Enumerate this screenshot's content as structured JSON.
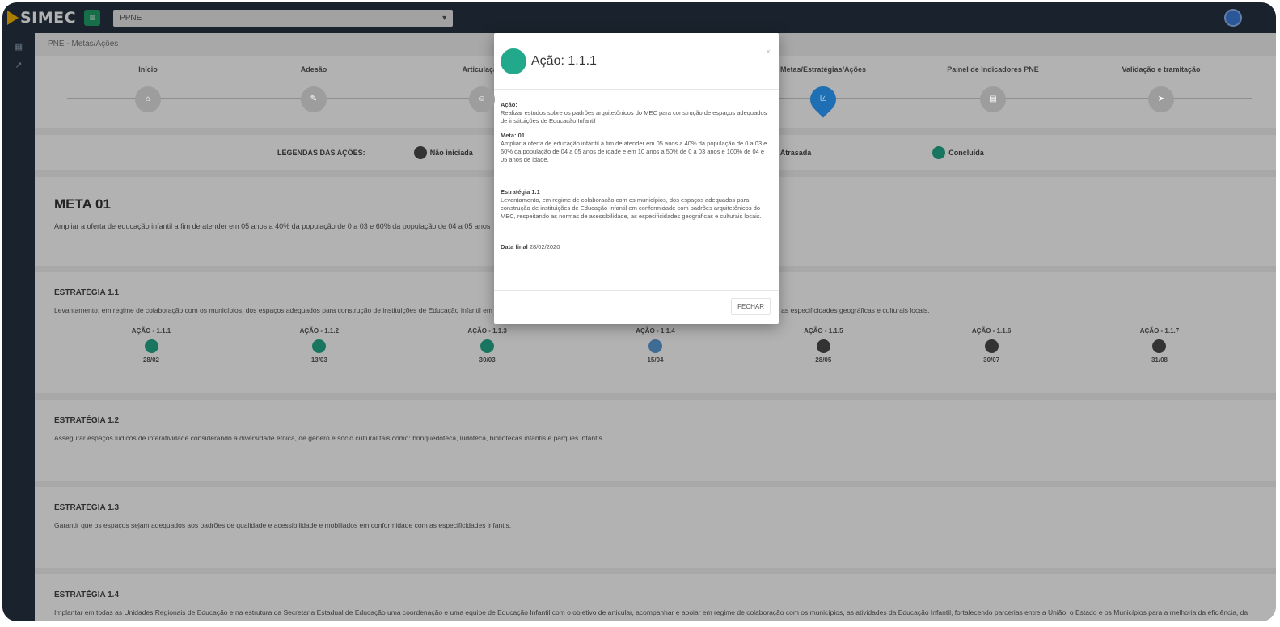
{
  "app": {
    "logo": "SIMEC",
    "select_value": "PPNE"
  },
  "breadcrumb": "PNE - Metas/Ações",
  "stepper": [
    {
      "label": "Início",
      "icon": "home-icon"
    },
    {
      "label": "Adesão",
      "icon": "handshake-icon"
    },
    {
      "label": "Articulação",
      "icon": "people-icon"
    },
    {
      "label": "",
      "icon": "doc-icon"
    },
    {
      "label": "Metas/Estratégias/Ações",
      "icon": "check-icon"
    },
    {
      "label": "Painel de Indicadores PNE",
      "icon": "chart-icon"
    },
    {
      "label": "Validação e tramitação",
      "icon": "send-icon"
    }
  ],
  "legend": {
    "title": "LEGENDAS DAS AÇÕES:",
    "not_started": "Não iniciada",
    "late": "Atrasada",
    "done": "Concluída",
    "colors": {
      "not_started": "#4a4a4a",
      "done": "#22a88a",
      "in_progress": "#5b9bd5"
    }
  },
  "meta": {
    "title": "META 01",
    "text": "Ampliar a oferta de educação infantil a fim de atender em 05 anos a 40% da população de 0 a 03 e 60% da população de 04 a 05 anos"
  },
  "estrategias": [
    {
      "title": "ESTRATÉGIA 1.1",
      "text": "Levantamento, em regime de colaboração com os municípios, dos espaços adequados para construção de instituições de Educação Infantil em conformidade com padrões arquitetônicos do MEC, respeitando as normas de acessibilidade, as especificidades geográficas e culturais locais.",
      "actions": [
        {
          "label": "AÇÃO - 1.1.1",
          "date": "28/02",
          "color": "#22a88a"
        },
        {
          "label": "AÇÃO - 1.1.2",
          "date": "13/03",
          "color": "#22a88a"
        },
        {
          "label": "AÇÃO - 1.1.3",
          "date": "30/03",
          "color": "#22a88a"
        },
        {
          "label": "AÇÃO - 1.1.4",
          "date": "15/04",
          "color": "#5b9bd5"
        },
        {
          "label": "AÇÃO - 1.1.5",
          "date": "28/05",
          "color": "#4a4a4a"
        },
        {
          "label": "AÇÃO - 1.1.6",
          "date": "30/07",
          "color": "#4a4a4a"
        },
        {
          "label": "AÇÃO - 1.1.7",
          "date": "31/08",
          "color": "#4a4a4a"
        }
      ]
    },
    {
      "title": "ESTRATÉGIA 1.2",
      "text": "Assegurar espaços lúdicos de interatividade considerando a diversidade étnica, de gênero e sócio cultural tais como: brinquedoteca, ludoteca, bibliotecas infantis e parques infantis."
    },
    {
      "title": "ESTRATÉGIA 1.3",
      "text": "Garantir que os espaços sejam adequados aos padrões de qualidade e acessibilidade e mobiliados em conformidade com as especificidades infantis."
    },
    {
      "title": "ESTRATÉGIA 1.4",
      "text": "Implantar em todas as Unidades Regionais de Educação e na estrutura da Secretaria Estadual de Educação uma coordenação e uma equipe de Educação Infantil com o objetivo de articular, acompanhar e apoiar em regime de colaboração com os municípios, as atividades da Educação Infantil, fortalecendo parcerias entre a União, o Estado e os Municípios para a melhoria da eficiência, da qualidade no atendimento à infância e a boa utilização dos planos, programas e projetos e legislação favorecedores da Edu."
    }
  ],
  "modal": {
    "title": "Ação: 1.1.1",
    "close": "×",
    "acao_label": "Ação:",
    "acao_text": "Realizar estudos sobre os padrões arquitetônicos do MEC para construção de espaços adequados de instituições de Educação Infantil",
    "meta_label": "Meta: 01",
    "meta_text": "Ampliar a oferta de educação infantil a fim de atender em 05 anos a 40% da população de 0 a 03 e 60% da população de 04 a 05 anos de idade e em 10 anos a 50% de 0 a 03 anos e 100% de 04 e 05 anos de idade.",
    "estrategia_label": "Estratégia 1.1",
    "estrategia_text": "Levantamento, em regime de colaboração com os municípios, dos espaços adequados para construção de instituições de Educação Infantil em conformidade com padrões arquitetônicos do MEC, respeitando as normas de acessibilidade, as especificidades geográficas e culturais locais.",
    "data_label": "Data final",
    "data_value": "28/02/2020",
    "button": "FECHAR"
  }
}
